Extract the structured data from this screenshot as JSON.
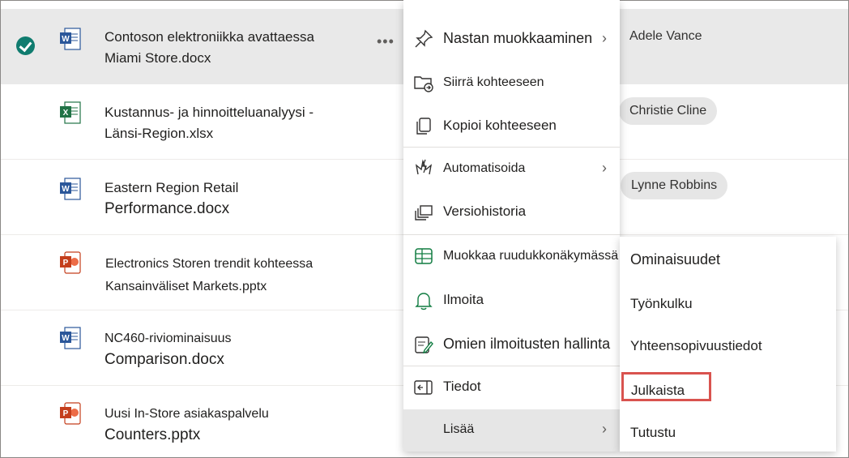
{
  "files": [
    {
      "line1": "Contoson elektroniikka avattaessa",
      "line2": "Miami Store.docx",
      "type": "word",
      "person": "Adele Vance",
      "selected": true
    },
    {
      "line1": "Kustannus- ja hinnoitteluanalyysi -",
      "line2": "Länsi-Region.xlsx",
      "type": "excel",
      "person": "Christie Cline"
    },
    {
      "line1": "Eastern Region Retail",
      "line2": "Performance.docx",
      "type": "word",
      "person": "Lynne Robbins"
    },
    {
      "line1": "Electronics Storen trendit kohteessa",
      "line2": "Kansainväliset Markets.pptx",
      "type": "ppt",
      "person": ""
    },
    {
      "line1": "NC460-riviominaisuus",
      "line2": "Comparison.docx",
      "type": "word",
      "person": ""
    },
    {
      "line1": "Uusi In-Store asiakaspalvelu",
      "line2": "Counters.pptx",
      "type": "ppt",
      "person": ""
    }
  ],
  "menu": {
    "items": [
      {
        "label": "Nastan muokkaaminen",
        "icon": "pin-icon",
        "chevron": true
      },
      {
        "label": "Siirrä kohteeseen",
        "icon": "move-folder-icon"
      },
      {
        "label": "Kopioi kohteeseen",
        "icon": "copy-icon"
      },
      {
        "label": "Automatisoida",
        "icon": "automate-icon",
        "chevron": true
      },
      {
        "label": "Versiohistoria",
        "icon": "version-history-icon"
      },
      {
        "label": "Muokkaa ruudukkonäkymässä",
        "icon": "grid-icon"
      },
      {
        "label": "Ilmoita",
        "icon": "bell-icon"
      },
      {
        "label": "Omien ilmoitusten hallinta",
        "icon": "manage-alerts-icon"
      },
      {
        "label": "Tiedot",
        "icon": "info-panel-icon"
      },
      {
        "label": "Lisää",
        "icon": "",
        "chevron": true
      }
    ]
  },
  "submenu": {
    "items": [
      "Ominaisuudet",
      "Työnkulku",
      "Yhteensopivuustiedot",
      "Julkaista",
      "Tutustu"
    ]
  },
  "colors": {
    "accent_check": "#107c6f",
    "highlight": "#d9534f",
    "word": "#2b579a",
    "excel": "#217346",
    "ppt": "#c43e1c"
  }
}
